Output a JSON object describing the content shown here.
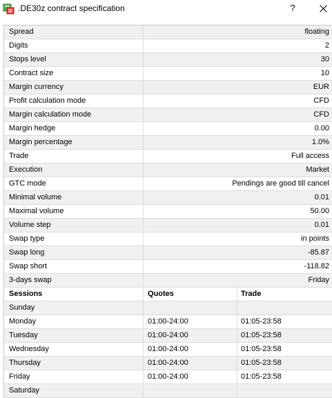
{
  "window": {
    "title": ".DE30z contract specification",
    "help_label": "?",
    "close_icon": "close-icon"
  },
  "specs": [
    {
      "name": "Spread",
      "value": "floating"
    },
    {
      "name": "Digits",
      "value": "2"
    },
    {
      "name": "Stops level",
      "value": "30"
    },
    {
      "name": "Contract size",
      "value": "10"
    },
    {
      "name": "Margin currency",
      "value": "EUR"
    },
    {
      "name": "Profit calculation mode",
      "value": "CFD"
    },
    {
      "name": "Margin calculation mode",
      "value": "CFD"
    },
    {
      "name": "Margin hedge",
      "value": "0.00"
    },
    {
      "name": "Margin percentage",
      "value": "1.0%"
    },
    {
      "name": "Trade",
      "value": "Full access"
    },
    {
      "name": "Execution",
      "value": "Market"
    },
    {
      "name": "GTC mode",
      "value": "Pendings are good till cancel"
    },
    {
      "name": "Minimal volume",
      "value": "0.01"
    },
    {
      "name": "Maximal volume",
      "value": "50.00"
    },
    {
      "name": "Volume step",
      "value": "0.01"
    },
    {
      "name": "Swap type",
      "value": "in points"
    },
    {
      "name": "Swap long",
      "value": "-85.87"
    },
    {
      "name": "Swap short",
      "value": "-118.82"
    },
    {
      "name": "3-days swap",
      "value": "Friday"
    }
  ],
  "sessions": {
    "headers": {
      "day": "Sessions",
      "quotes": "Quotes",
      "trade": "Trade"
    },
    "rows": [
      {
        "day": "Sunday",
        "quotes": "",
        "trade": ""
      },
      {
        "day": "Monday",
        "quotes": "01:00-24:00",
        "trade": "01:05-23:58"
      },
      {
        "day": "Tuesday",
        "quotes": "01:00-24:00",
        "trade": "01:05-23:58"
      },
      {
        "day": "Wednesday",
        "quotes": "01:00-24:00",
        "trade": "01:05-23:58"
      },
      {
        "day": "Thursday",
        "quotes": "01:00-24:00",
        "trade": "01:05-23:58"
      },
      {
        "day": "Friday",
        "quotes": "01:00-24:00",
        "trade": "01:05-23:58"
      },
      {
        "day": "Saturday",
        "quotes": "",
        "trade": ""
      }
    ]
  }
}
